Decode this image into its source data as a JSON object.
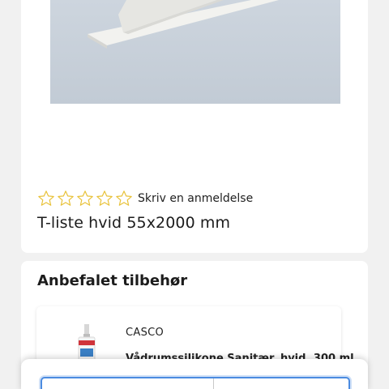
{
  "product": {
    "image_alt": "T-liste hvid",
    "title": "T-liste hvid 55x2000 mm",
    "rating": {
      "stars": 0,
      "max_stars": 5,
      "review_link": "Skriv en anmeldelse"
    }
  },
  "accessories": {
    "heading": "Anbefalet tilbehør",
    "items": [
      {
        "brand": "CASCO",
        "name": "Vådrumssilikone Sanitær, hvid, 300 ml"
      }
    ]
  },
  "colors": {
    "star_outline": "#e8c23a",
    "accent_border": "#4b8be0"
  }
}
